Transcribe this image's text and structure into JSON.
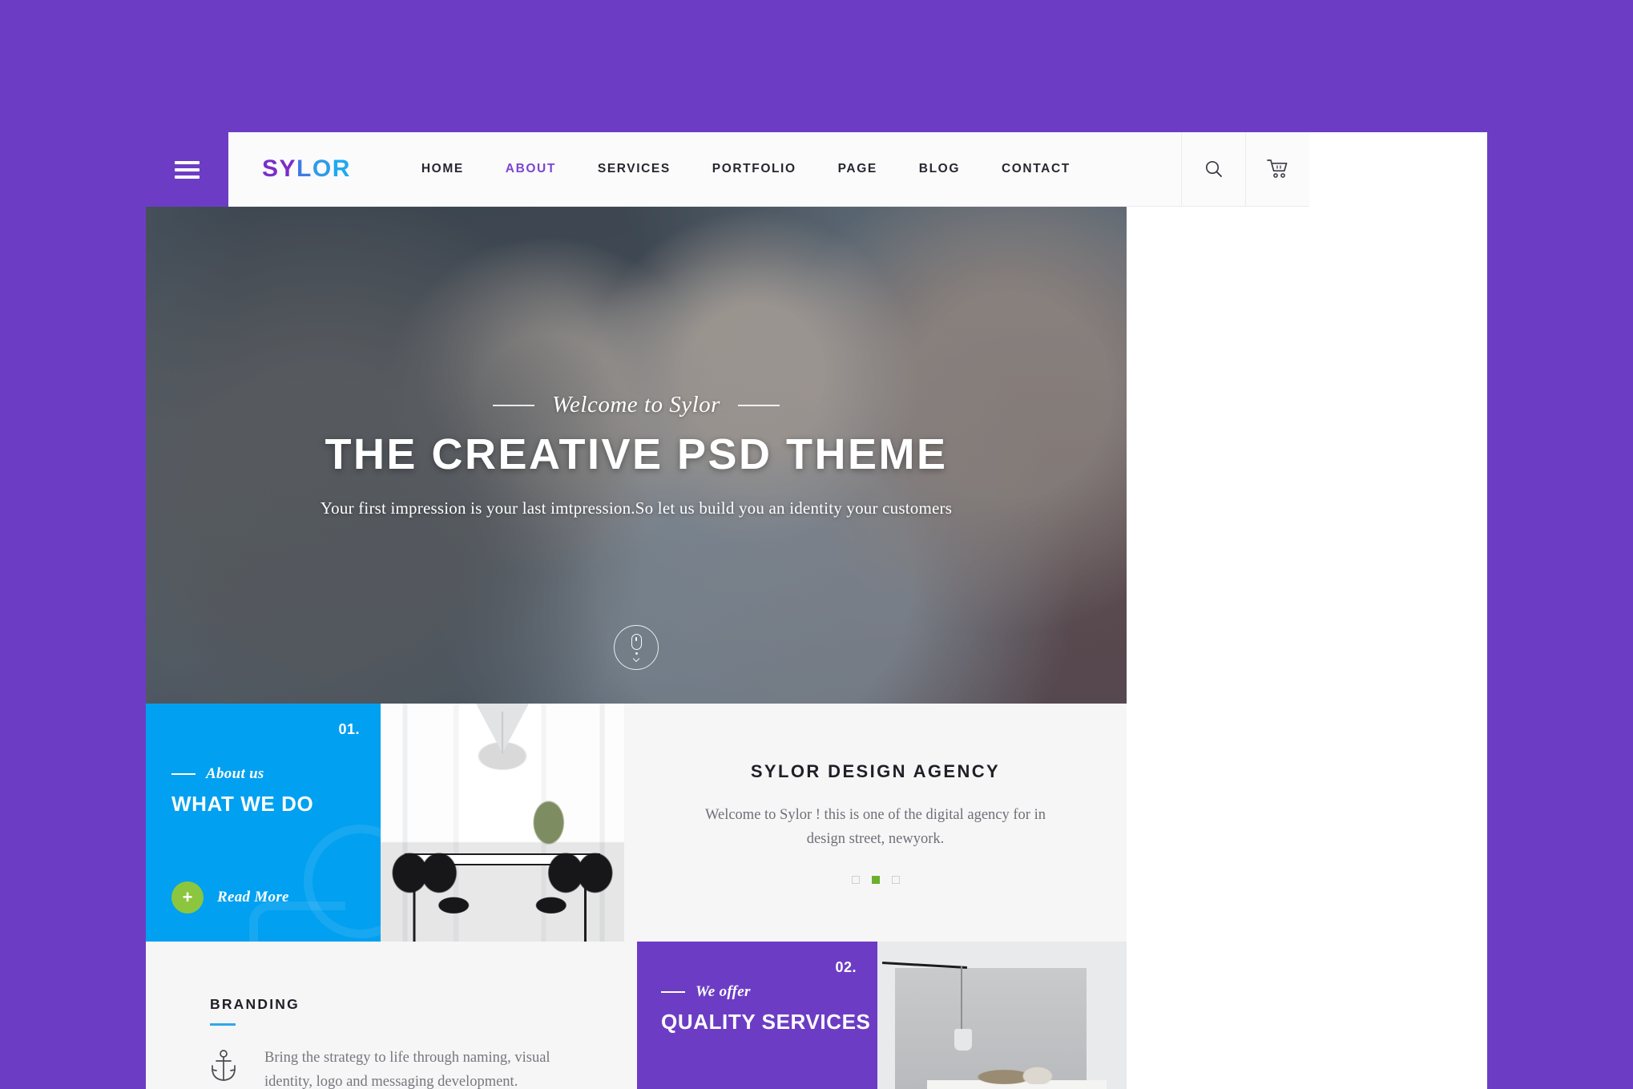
{
  "theme": {
    "purple": "#6C3DC4",
    "blue": "#01A0F0",
    "green": "#8CC63E",
    "accent_blue": "#2FA8E8",
    "light_gray": "#F6F6F7"
  },
  "header": {
    "menu_icon": "hamburger-icon",
    "logo": {
      "part1": "SY",
      "part2": "L",
      "part3": "O",
      "part4": "R",
      "full": "SYLOR"
    },
    "nav": [
      {
        "label": "HOME",
        "active": false
      },
      {
        "label": "ABOUT",
        "active": true
      },
      {
        "label": "SERVICES",
        "active": false
      },
      {
        "label": "PORTFOLIO",
        "active": false
      },
      {
        "label": "PAGE",
        "active": false
      },
      {
        "label": "BLOG",
        "active": false
      },
      {
        "label": "CONTACT",
        "active": false
      }
    ],
    "search_icon": "search-icon",
    "cart_icon": "shopping-cart-icon"
  },
  "hero": {
    "kicker": "Welcome to Sylor",
    "title": "THE CREATIVE PSD THEME",
    "subtitle": "Your first impression is your last imtpression.So let us build you an identity  your customers",
    "scroll_icon": "mouse-scroll-icon"
  },
  "about": {
    "number": "01.",
    "kicker": "About us",
    "heading": "WHAT WE DO",
    "cta": {
      "label": "Read More",
      "icon": "plus-icon"
    },
    "photo_alt": "dining-room-interior",
    "panel": {
      "title": "SYLOR DESIGN AGENCY",
      "text": "Welcome to Sylor ! this is one of the digital agency for in design street, newyork.",
      "dots": [
        {
          "active": false
        },
        {
          "active": true
        },
        {
          "active": false
        }
      ]
    }
  },
  "branding": {
    "title": "BRANDING",
    "icon": "anchor-icon",
    "text": "Bring the strategy to life through naming, visual identity, logo and messaging development."
  },
  "offer": {
    "number": "02.",
    "kicker": "We offer",
    "heading": "QUALITY SERVICES",
    "photo_alt": "minimal-interior-pendant-lamp"
  }
}
